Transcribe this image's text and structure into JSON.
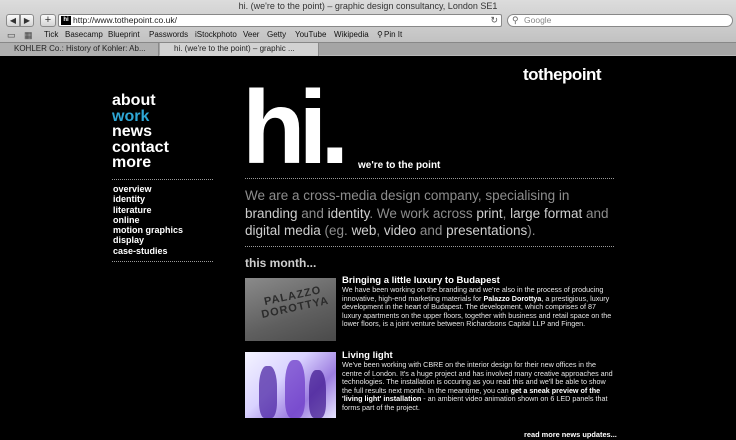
{
  "browser": {
    "window_title": "hi. (we're to the point) – graphic design consultancy, London SE1",
    "back_label": "◀",
    "forward_label": "▶",
    "add_label": "+",
    "url": "http://www.tothepoint.co.uk/",
    "search_placeholder": "Google",
    "bookmarks": [
      "Tick",
      "Basecamp",
      "Blueprint",
      "Passwords",
      "iStockphoto",
      "Veer",
      "Getty",
      "YouTube",
      "Wikipedia",
      "Pin It"
    ],
    "tabs": [
      "KOHLER Co.: History of Kohler: Ab...",
      "hi. (we're to the point) – graphic ..."
    ]
  },
  "site": {
    "logo": "tothepoint",
    "main_nav": [
      "about",
      "work",
      "news",
      "contact",
      "more"
    ],
    "active_nav": "work",
    "sub_nav": [
      "overview",
      "identity",
      "literature",
      "online",
      "motion graphics",
      "display",
      "case-studies"
    ],
    "hero": "hi.",
    "tagline": "we're to the point",
    "intro": {
      "t1": "We are a cross-media design company, specialising in ",
      "b1": "branding",
      "t2": " and ",
      "b2": "identity",
      "t3": ". We work across ",
      "b3": "print",
      "t4": ", ",
      "b4": "large format",
      "t5": " and ",
      "b5": "digital media",
      "t6": " (eg. ",
      "b6": "web",
      "t7": ", ",
      "b7": "video",
      "t8": " and ",
      "b8": "presentations",
      "t9": ")."
    },
    "this_month": "this month...",
    "news": [
      {
        "title": "Bringing a little luxury to Budapest",
        "p1": "We have been working on the branding and we're also in the process of producing innovative, high-end marketing materials for ",
        "b1": "Palazzo Dorottya",
        "p2": ", a prestigious, luxury development in the heart of Budapest. The development, which comprises of 87 luxury apartments on the upper floors, together with business and retail space on the lower floors, is a joint venture between Richardsons Capital LLP and Fingen.",
        "thumb_text": "PALAZZO DOROTTYA"
      },
      {
        "title": "Living light",
        "p1": "We've been working with CBRE on the interior design for their new offices in the centre of London. It's a huge project and has involved many creative approaches and technologies. The installation is occuring as you read this and we'll be able to show the full results next month. In the meantime, you can ",
        "b1": "get a sneak preview of the 'living light' installation",
        "p2": " - an ambient video animation shown on 6 LED panels that forms part of the project."
      }
    ],
    "more_news": "read more news updates..."
  }
}
